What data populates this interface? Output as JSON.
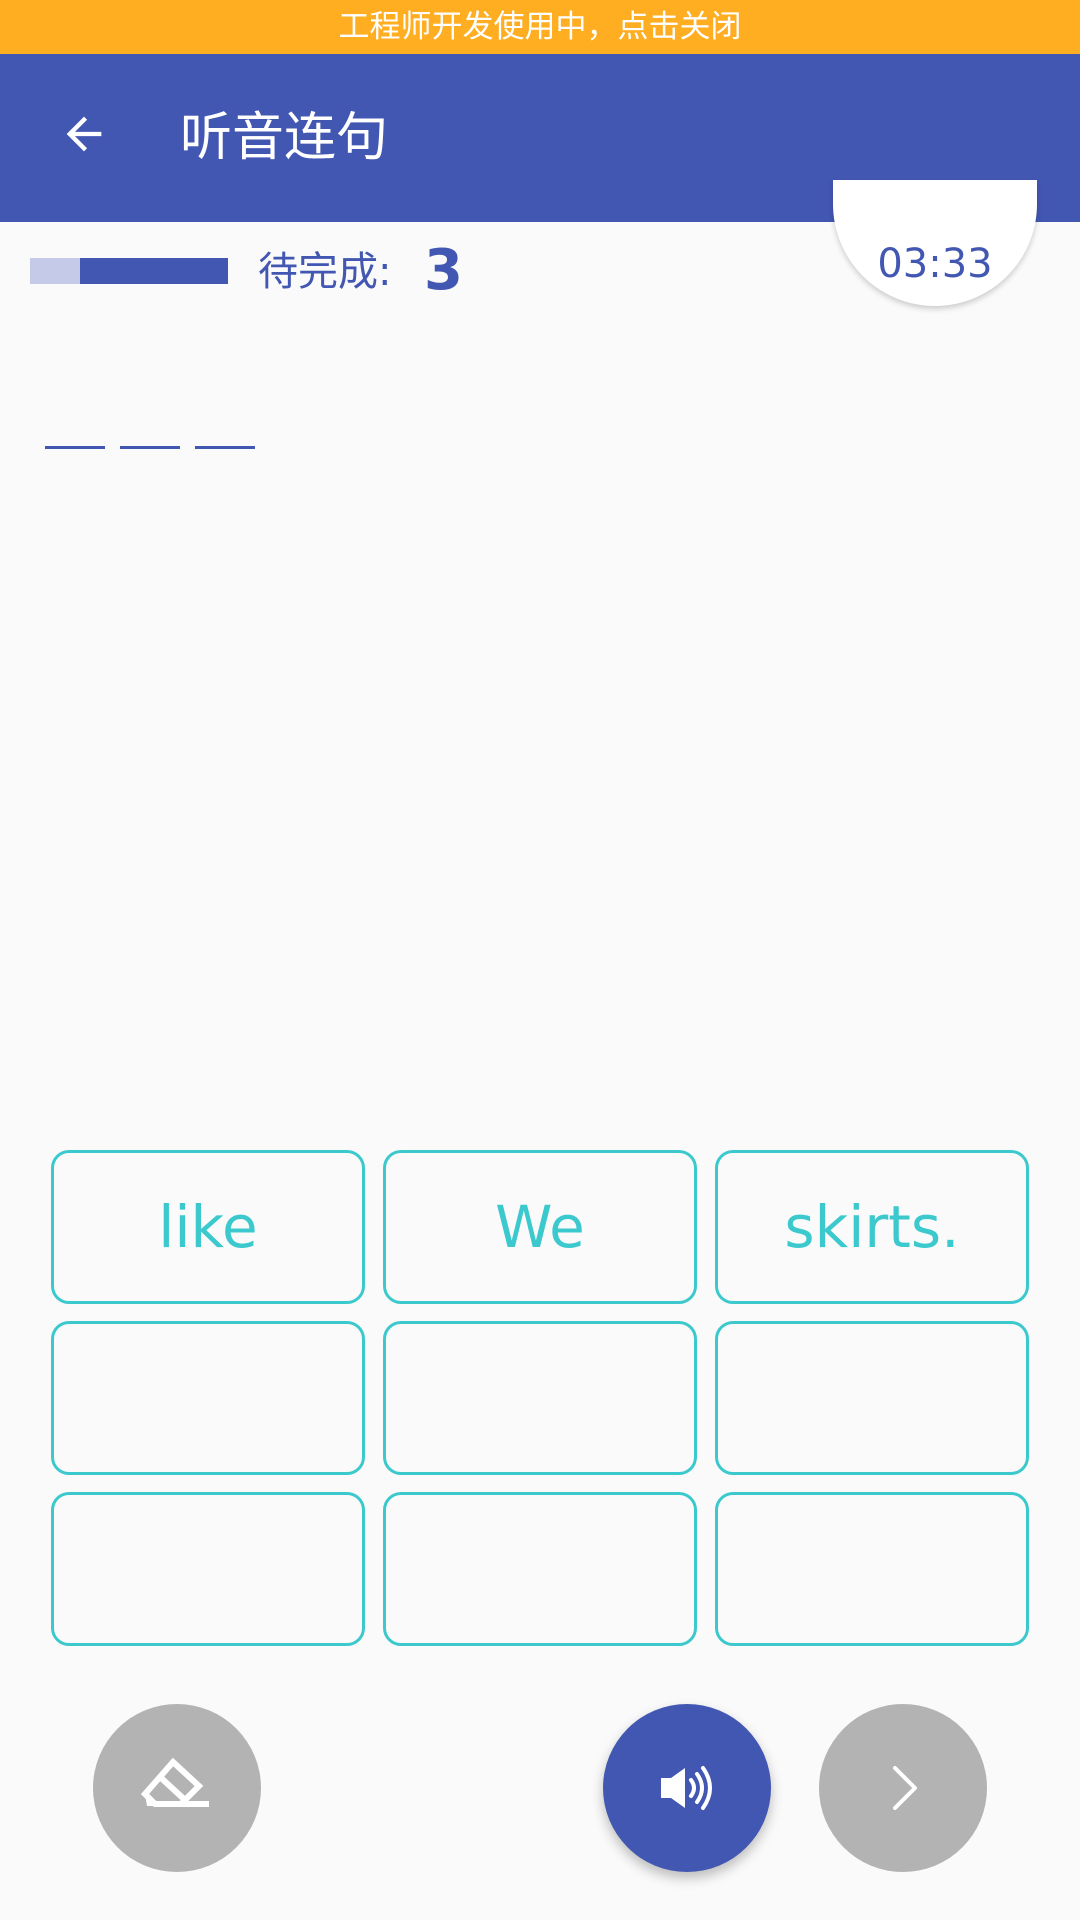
{
  "dev_banner": {
    "text": "工程师开发使用中，点击关闭"
  },
  "app_bar": {
    "title": "听音连句",
    "back_icon": "arrow-left-icon"
  },
  "status": {
    "progress_fraction": 0.25,
    "pending_label": "待完成:",
    "pending_count": "3",
    "timer": "03:33"
  },
  "answer": {
    "blank_count": 3
  },
  "word_options": [
    "like",
    "We",
    "skirts.",
    "",
    "",
    "",
    "",
    "",
    ""
  ],
  "actions": {
    "erase_icon": "eraser-icon",
    "play_icon": "speaker-icon",
    "next_icon": "chevron-right-icon"
  },
  "colors": {
    "banner": "#ffad21",
    "primary": "#4257b2",
    "primary_light": "#c5cae9",
    "accent": "#3cc9cd",
    "disabled": "#b3b3b3",
    "background": "#fafafa"
  }
}
